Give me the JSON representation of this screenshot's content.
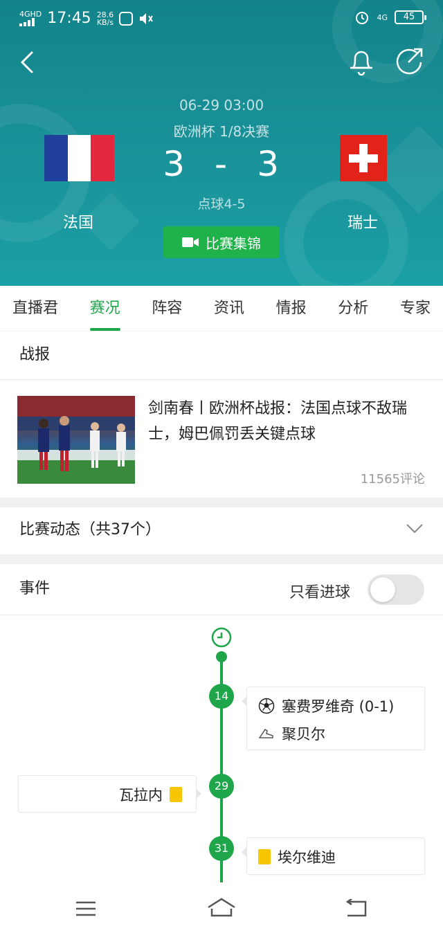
{
  "status_bar": {
    "network": "4G",
    "network_sup": "HD",
    "time": "17:45",
    "speed_value": "28.6",
    "speed_unit": "KB/s",
    "battery": "45"
  },
  "match": {
    "datetime": "06-29 03:00",
    "competition": "欧洲杯 1/8决赛",
    "home_team": "法国",
    "away_team": "瑞士",
    "home_score": "3",
    "away_score": "3",
    "separator": "-",
    "penalties": "点球4-5",
    "highlights_label": "比赛集锦"
  },
  "tabs": [
    {
      "label": "直播君"
    },
    {
      "label": "赛况",
      "active": true
    },
    {
      "label": "阵容"
    },
    {
      "label": "资讯"
    },
    {
      "label": "情报"
    },
    {
      "label": "分析"
    },
    {
      "label": "专家"
    }
  ],
  "report": {
    "section_title": "战报",
    "headline": "剑南春丨欧洲杯战报：法国点球不敌瑞士，姆巴佩罚丢关键点球",
    "comments": "11565评论"
  },
  "dynamics": {
    "title": "比赛动态（共37个）"
  },
  "events": {
    "title": "事件",
    "filter_label": "只看进球",
    "items": [
      {
        "minute": "14",
        "side": "away",
        "scorer": "塞费罗维奇 (0-1)",
        "assist": "聚贝尔"
      },
      {
        "minute": "29",
        "side": "home",
        "player": "瓦拉内",
        "type": "yellow-card"
      },
      {
        "minute": "31",
        "side": "away",
        "player": "埃尔维迪",
        "type": "yellow-card"
      }
    ]
  },
  "colors": {
    "accent": "#1fa64b",
    "header_bg": "#168f95",
    "yellow_card": "#f7c600",
    "france_blue": "#1f3f9a",
    "france_red": "#e3283e",
    "swiss_red": "#e2231a"
  }
}
